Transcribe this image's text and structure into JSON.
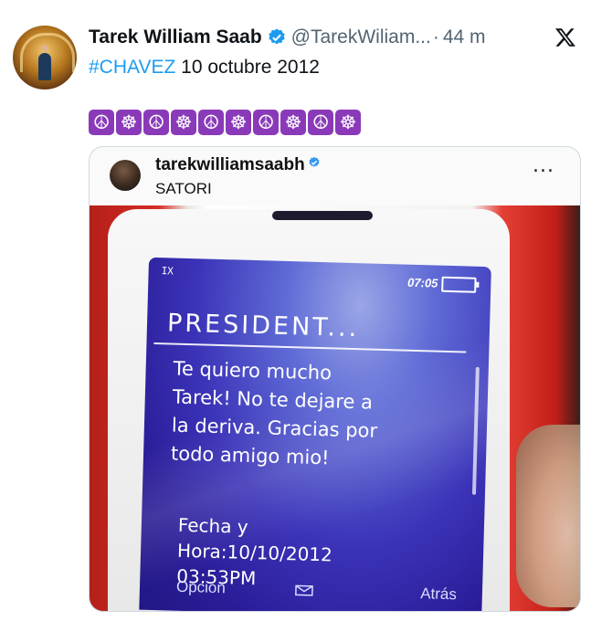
{
  "tweet": {
    "author_name": "Tarek William Saab",
    "handle": "@TarekWiliam...",
    "separator": "·",
    "time": "44 m",
    "hashtag": "#CHAVEZ",
    "date_text": " 10 octubre 2012",
    "emojis": [
      "☮",
      "☸",
      "☮",
      "☸",
      "☮",
      "☸",
      "☮",
      "☸",
      "☮",
      "☸"
    ],
    "colors": {
      "link": "#1d9bf0",
      "verified": "#1d9bf0",
      "emoji_bg": "#8a3ab9"
    }
  },
  "post_image": {
    "ig_username": "tarekwilliamsaabh",
    "ig_location": "SATORI",
    "more_icon": "...",
    "phone": {
      "signal": "IX",
      "clock": "07:05",
      "title": "PRESIDENT...",
      "message": "Te quiero mucho\nTarek! No te dejare a\nla deriva. Gracias por\ntodo amigo mio!",
      "datetime": "Fecha y\nHora:10/10/2012\n03:53PM",
      "left_softkey": "Opción",
      "right_softkey": "Atrás"
    }
  }
}
